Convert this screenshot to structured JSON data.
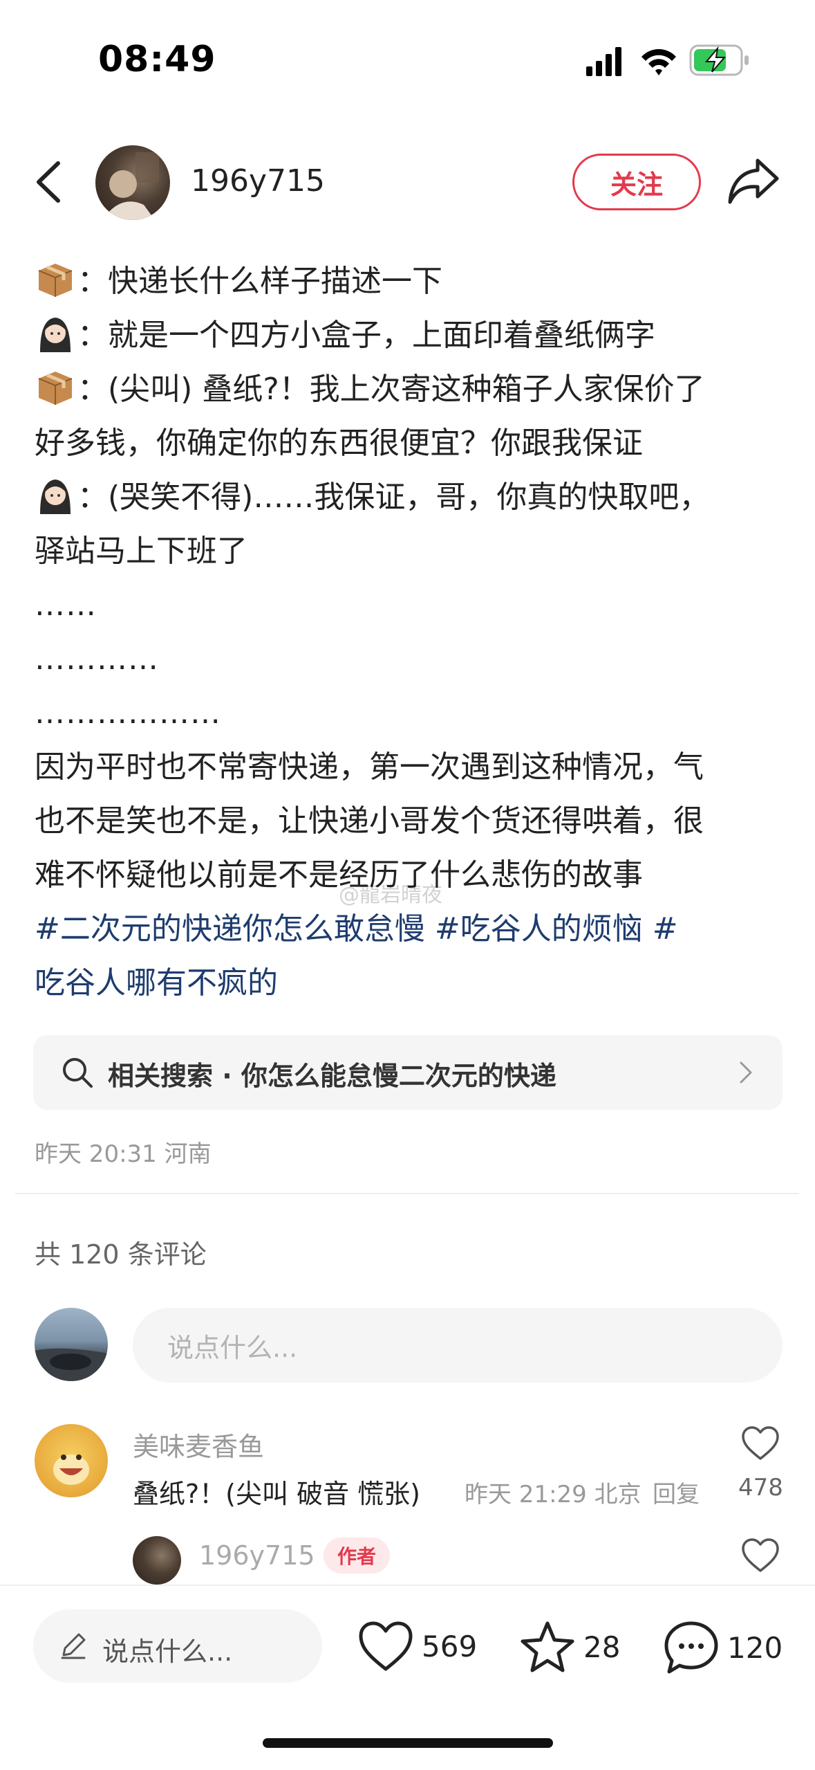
{
  "status_bar": {
    "time": "08:49"
  },
  "header": {
    "author_name": "196y715",
    "follow_label": "关注"
  },
  "content": {
    "lines": [
      {
        "speaker": "box",
        "text": "：快递长什么样子描述一下"
      },
      {
        "speaker": "girl",
        "text": "：就是一个四方小盒子，上面印着叠纸俩字"
      },
      {
        "speaker": "box",
        "text": "：(尖叫) 叠纸?！我上次寄这种箱子人家保价了"
      },
      {
        "speaker": "",
        "text": "好多钱，你确定你的东西很便宜？你跟我保证"
      },
      {
        "speaker": "girl",
        "text": "：(哭笑不得)……我保证，哥，你真的快取吧，"
      },
      {
        "speaker": "",
        "text": "驿站马上下班了"
      }
    ],
    "dots": [
      "……",
      "…………",
      "………………"
    ],
    "paragraph_lines": [
      "因为平时也不常寄快递，第一次遇到这种情况，气",
      "也不是笑也不是，让快递小哥发个货还得哄着，很",
      "难不怀疑他以前是不是经历了什么悲伤的故事"
    ],
    "tags": {
      "tag1": " #二次元的快递你怎么敢怠慢",
      "tag2": "  #吃谷人的烦恼",
      "tag3_start": "  #",
      "tag3_end": "吃谷人哪有不疯的"
    }
  },
  "watermark": "@龍岩晴夜",
  "related_search": "相关搜索 · 你怎么能怠慢二次元的快递",
  "post_meta": "昨天 20:31 河南",
  "comments_header": "共 120 条评论",
  "comment_input_placeholder": "说点什么...",
  "comments": [
    {
      "user": "美味麦香鱼",
      "text": "叠纸?！(尖叫 破音 慌张)",
      "time": "昨天 21:29 北京",
      "reply": "回复",
      "likes": "478"
    },
    {
      "user": "196y715",
      "badge": "作者"
    }
  ],
  "bottom_bar": {
    "input_placeholder": "说点什么...",
    "likes": "569",
    "favorites": "28",
    "comments": "120"
  }
}
